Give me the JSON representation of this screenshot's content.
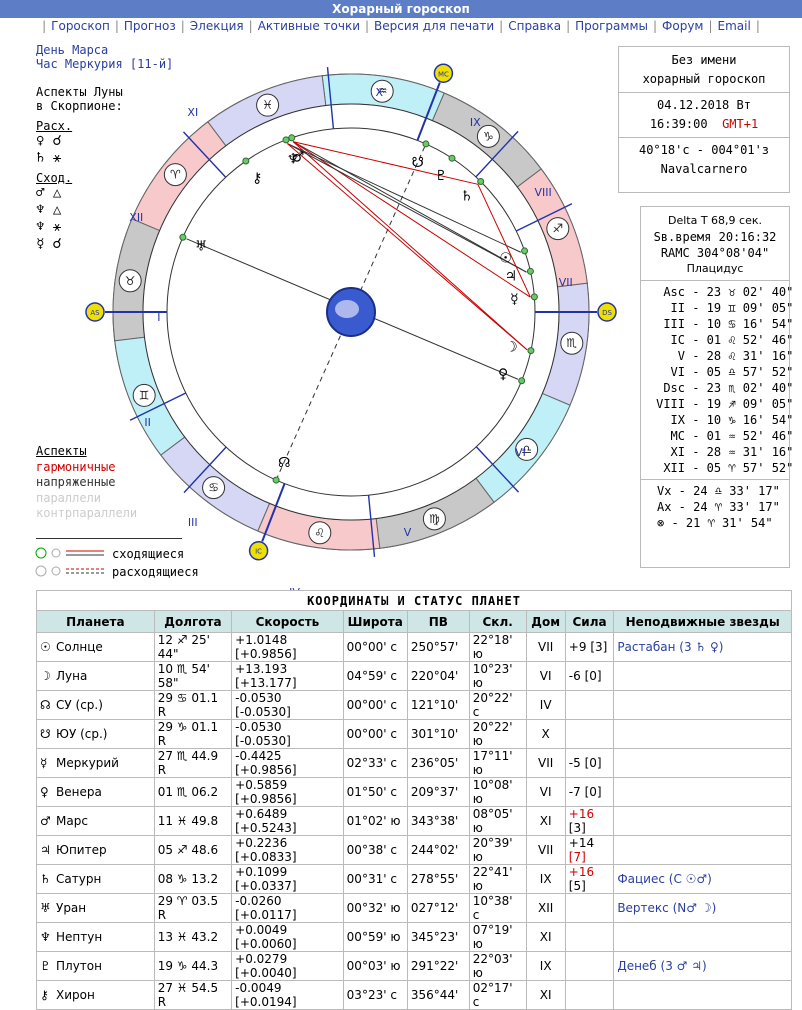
{
  "title": "Хорарный гороскоп",
  "menu": [
    "Гороскоп",
    "Прогноз",
    "Элекция",
    "Активные точки",
    "Версия для печати",
    "Справка",
    "Программы",
    "Форум",
    "Email"
  ],
  "left": {
    "day": "День Марса",
    "hour": "Час Меркурия [11-й]",
    "moon_aspects_1": "Аспекты Луны",
    "moon_aspects_2": "в Скорпионе:",
    "separating": "Расх.",
    "applying": "Сход.",
    "aspects_title": "Аспекты",
    "harmonic": "гармоничные",
    "tense": "напряженные",
    "parallels": "параллели",
    "contraparallels": "контрпараллели",
    "converging": "сходящиеся",
    "diverging": "расходящиеся"
  },
  "info": {
    "name": "Без имени",
    "type": "хорарный гороскоп",
    "date": "04.12.2018 Вт",
    "time": "16:39:00",
    "tz": "GMT+1",
    "coords": "40°18'с - 004°01'з",
    "place": "Navalcarnero"
  },
  "info2": {
    "delta": "Delta T  68,9 сек.",
    "stime": "Sв.время 20:16:32",
    "ramc": "RAMC 304°08'04\"",
    "system": "Плацидус",
    "cusps": [
      [
        "Asc",
        "23 ♉ 02' 40\""
      ],
      [
        "II",
        "19 ♊ 09' 05\""
      ],
      [
        "III",
        "10 ♋ 16' 54\""
      ],
      [
        "IC",
        "01 ♌ 52' 46\""
      ],
      [
        "V",
        "28 ♌ 31' 16\""
      ],
      [
        "VI",
        "05 ♎ 57' 52\""
      ],
      [
        "Dsc",
        "23 ♏ 02' 40\""
      ],
      [
        "VIII",
        "19 ♐ 09' 05\""
      ],
      [
        "IX",
        "10 ♑ 16' 54\""
      ],
      [
        "MC",
        "01 ♒ 52' 46\""
      ],
      [
        "XI",
        "28 ♒ 31' 16\""
      ],
      [
        "XII",
        "05 ♈ 57' 52\""
      ]
    ],
    "points": [
      [
        "Vx",
        "24 ♎ 33' 17\""
      ],
      [
        "Ax",
        "24 ♈ 33' 17\""
      ],
      [
        "⊗",
        "21 ♈ 31' 54\""
      ]
    ]
  },
  "chart": {
    "houses": [
      "I",
      "II",
      "III",
      "IV",
      "V",
      "VI",
      "VII",
      "VIII",
      "IX",
      "X",
      "XI",
      "XII"
    ],
    "labels": {
      "asc": "AS",
      "dsc": "DS",
      "mc": "MC",
      "ic": "IC"
    }
  },
  "table": {
    "title": "КООРДИНАТЫ И СТАТУС ПЛАНЕТ",
    "headers": [
      "Планета",
      "Долгота",
      "Скорость",
      "Широта",
      "ПВ",
      "Скл.",
      "Дом",
      "Сила",
      "Неподвижные звезды"
    ],
    "rows": [
      {
        "glyph": "☉",
        "name": "Солнце",
        "lon": "12 ♐ 25' 44\"",
        "speed": "+1.0148 [+0.9856]",
        "lat": "00°00' с",
        "ra": "250°57'",
        "dec": "22°18' ю",
        "house": "VII",
        "force": "+9",
        "forcebr": "[3]",
        "forcered": false,
        "brred": false,
        "star": "Растабан (3 ♄ ♀)"
      },
      {
        "glyph": "☽",
        "name": "Луна",
        "lon": "10 ♏ 54' 58\"",
        "speed": "+13.193 [+13.177]",
        "lat": "04°59' с",
        "ra": "220°04'",
        "dec": "10°23' ю",
        "house": "VI",
        "force": "-6",
        "forcebr": "[0]",
        "forcered": false,
        "brred": false,
        "star": ""
      },
      {
        "glyph": "☊",
        "name": "СУ (ср.)",
        "lon": "29 ♋ 01.1  R",
        "speed": "-0.0530 [-0.0530]",
        "lat": "00°00' с",
        "ra": "121°10'",
        "dec": "20°22' с",
        "house": "IV",
        "force": "",
        "forcebr": "",
        "forcered": false,
        "brred": false,
        "star": ""
      },
      {
        "glyph": "☋",
        "name": "ЮУ (ср.)",
        "lon": "29 ♑ 01.1  R",
        "speed": "-0.0530 [-0.0530]",
        "lat": "00°00' с",
        "ra": "301°10'",
        "dec": "20°22' ю",
        "house": "X",
        "force": "",
        "forcebr": "",
        "forcered": false,
        "brred": false,
        "star": ""
      },
      {
        "glyph": "☿",
        "name": "Меркурий",
        "lon": "27 ♏ 44.9  R",
        "speed": "-0.4425 [+0.9856]",
        "lat": "02°33' с",
        "ra": "236°05'",
        "dec": "17°11' ю",
        "house": "VII",
        "force": "-5",
        "forcebr": "[0]",
        "forcered": false,
        "brred": false,
        "star": ""
      },
      {
        "glyph": "♀",
        "name": "Венера",
        "lon": "01 ♏ 06.2",
        "speed": "+0.5859 [+0.9856]",
        "lat": "01°50' с",
        "ra": "209°37'",
        "dec": "10°08' ю",
        "house": "VI",
        "force": "-7",
        "forcebr": "[0]",
        "forcered": false,
        "brred": false,
        "star": ""
      },
      {
        "glyph": "♂",
        "name": "Марс",
        "lon": "11 ♓ 49.8",
        "speed": "+0.6489 [+0.5243]",
        "lat": "01°02' ю",
        "ra": "343°38'",
        "dec": "08°05' ю",
        "house": "XI",
        "force": "+16",
        "forcebr": "[3]",
        "forcered": true,
        "brred": false,
        "star": ""
      },
      {
        "glyph": "♃",
        "name": "Юпитер",
        "lon": "05 ♐ 48.6",
        "speed": "+0.2236 [+0.0833]",
        "lat": "00°38' с",
        "ra": "244°02'",
        "dec": "20°39' ю",
        "house": "VII",
        "force": "+14",
        "forcebr": "[7]",
        "forcered": false,
        "brred": true,
        "star": ""
      },
      {
        "glyph": "♄",
        "name": "Сатурн",
        "lon": "08 ♑ 13.2",
        "speed": "+0.1099 [+0.0337]",
        "lat": "00°31' с",
        "ra": "278°55'",
        "dec": "22°41' ю",
        "house": "IX",
        "force": "+16",
        "forcebr": "[5]",
        "forcered": true,
        "brred": false,
        "star": "Фациес (С ☉♂)"
      },
      {
        "glyph": "♅",
        "name": "Уран",
        "lon": "29 ♈ 03.5  R",
        "speed": "-0.0260 [+0.0117]",
        "lat": "00°32' ю",
        "ra": "027°12'",
        "dec": "10°38' с",
        "house": "XII",
        "force": "",
        "forcebr": "",
        "forcered": false,
        "brred": false,
        "star": "Вертекс (N♂ ☽)"
      },
      {
        "glyph": "♆",
        "name": "Нептун",
        "lon": "13 ♓ 43.2",
        "speed": "+0.0049 [+0.0060]",
        "lat": "00°59' ю",
        "ra": "345°23'",
        "dec": "07°19' ю",
        "house": "XI",
        "force": "",
        "forcebr": "",
        "forcered": false,
        "brred": false,
        "star": ""
      },
      {
        "glyph": "♇",
        "name": "Плутон",
        "lon": "19 ♑ 44.3",
        "speed": "+0.0279 [+0.0040]",
        "lat": "00°03' ю",
        "ra": "291°22'",
        "dec": "22°03' ю",
        "house": "IX",
        "force": "",
        "forcebr": "",
        "forcered": false,
        "brred": false,
        "star": "Денеб (3 ♂ ♃)"
      },
      {
        "glyph": "⚷",
        "name": "Хирон",
        "lon": "27 ♓ 54.5  R",
        "speed": "-0.0049 [+0.0194]",
        "lat": "03°23' с",
        "ra": "356°44'",
        "dec": "02°17' с",
        "house": "XI",
        "force": "",
        "forcebr": "",
        "forcered": false,
        "brred": false,
        "star": ""
      }
    ]
  }
}
